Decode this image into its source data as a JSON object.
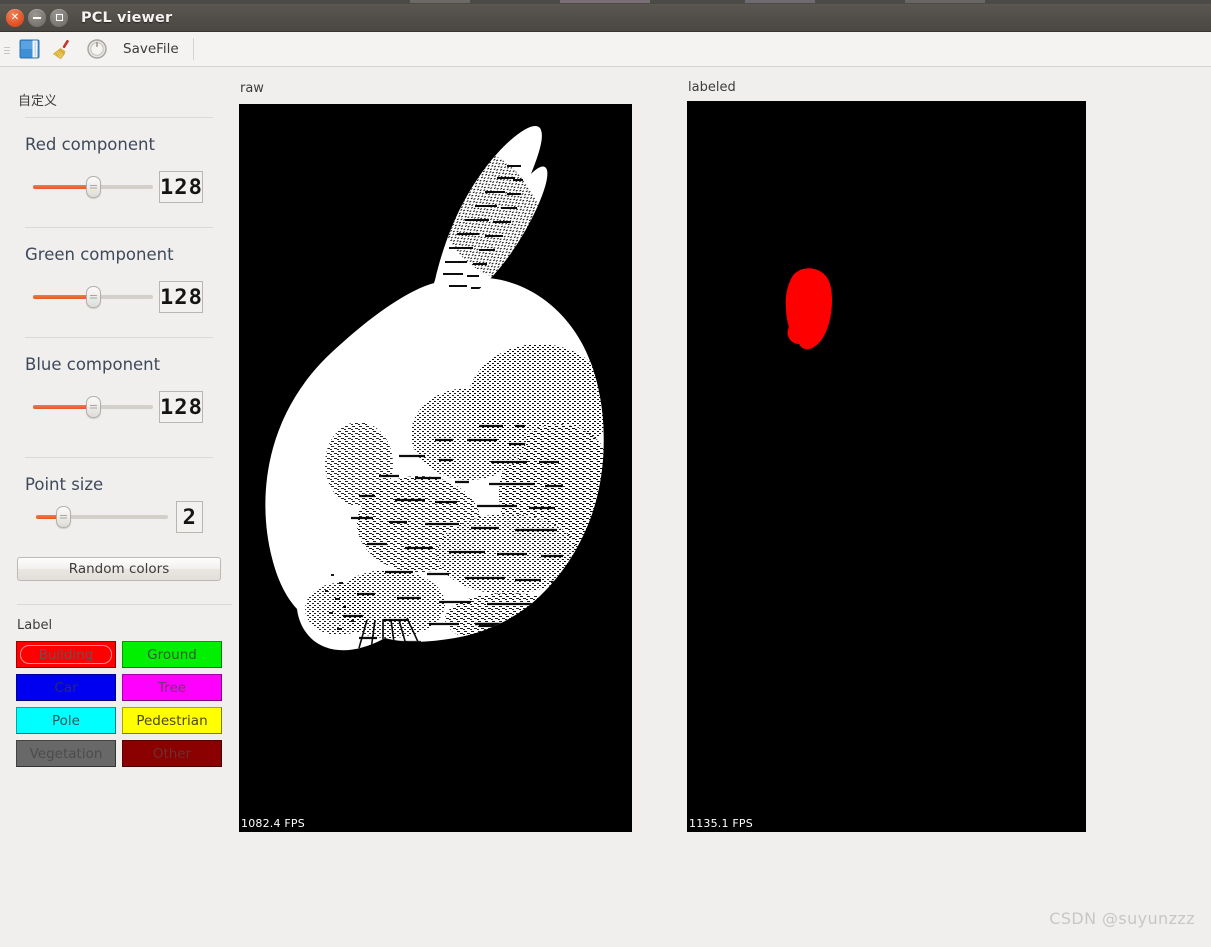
{
  "window": {
    "title": "PCL viewer",
    "controls": {
      "close": "×",
      "minimize": "−",
      "maximize": "□"
    }
  },
  "toolbar": {
    "open_icon": "folder-open-icon",
    "clear_icon": "broom-icon",
    "reset_icon": "circle-arrow-icon",
    "savefile_label": "SaveFile"
  },
  "sidebar": {
    "title": "自定义",
    "groups": [
      {
        "label": "Red component",
        "value": "128",
        "slider_pct": 50
      },
      {
        "label": "Green component",
        "value": "128",
        "slider_pct": 50
      },
      {
        "label": "Blue component",
        "value": "128",
        "slider_pct": 50
      },
      {
        "label": "Point size",
        "value": "2",
        "slider_pct": 20
      }
    ],
    "random_colors_label": "Random colors",
    "label_section": {
      "heading": "Label",
      "buttons": [
        {
          "name": "Building",
          "bg": "#ff0000",
          "fg": "#6a5050",
          "focused": true
        },
        {
          "name": "Ground",
          "bg": "#00f000",
          "fg": "#3a5a3a",
          "focused": false
        },
        {
          "name": "Car",
          "bg": "#0000f0",
          "fg": "#2a2a6a",
          "focused": false
        },
        {
          "name": "Tree",
          "bg": "#ff00ff",
          "fg": "#6a3a6a",
          "focused": false
        },
        {
          "name": "Pole",
          "bg": "#00ffff",
          "fg": "#2a5a5a",
          "focused": false
        },
        {
          "name": "Pedestrian",
          "bg": "#ffff00",
          "fg": "#4a4a10",
          "focused": false
        },
        {
          "name": "Vegetation",
          "bg": "#686868",
          "fg": "#4c4c4c",
          "focused": false
        },
        {
          "name": "Other",
          "bg": "#8b0000",
          "fg": "#6b3030",
          "focused": false
        }
      ]
    }
  },
  "viewports": [
    {
      "title": "raw",
      "fps": "1082.4 FPS",
      "background": "#000000",
      "cloud_color": "#ffffff"
    },
    {
      "title": "labeled",
      "fps": "1135.1 FPS",
      "background": "#000000",
      "cloud_color": "#ff0000"
    }
  ],
  "watermark": "CSDN @suyunzzz"
}
